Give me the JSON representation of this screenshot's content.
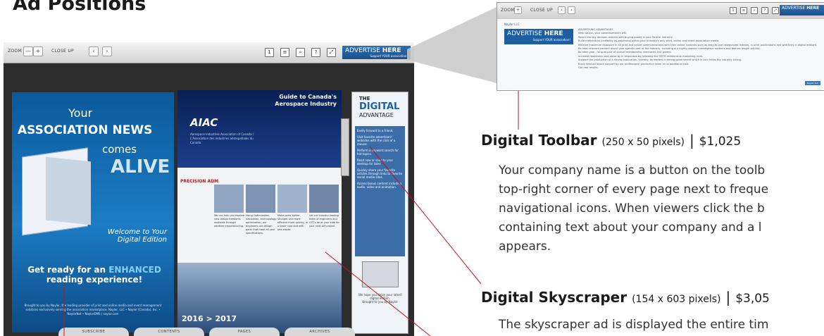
{
  "heading": "Ad Positions",
  "viewer": {
    "toolbar": {
      "zoom_label": "ZOOM",
      "minus": "—",
      "plus": "+",
      "closeup_label": "CLOSE UP",
      "prev": "‹",
      "next": "›",
      "icons": [
        "page-icon",
        "grid-icon",
        "search-icon",
        "help-icon",
        "fullscreen-icon"
      ],
      "icon_glyphs": [
        "1",
        "≡",
        "⌕",
        "?",
        "⤢"
      ],
      "advertise_main": "ADVERTISE ",
      "advertise_here": "HERE",
      "advertise_sub": "Support YOUR association!"
    },
    "cover": {
      "your": "Your",
      "assoc_news": "ASSOCIATION NEWS",
      "comes": "comes",
      "alive": "ALIVE",
      "welcome": "Welcome to Your Digital Edition",
      "get_ready": "Get ready for an ",
      "enhanced": "ENHANCED",
      "reading_exp": "reading experience!",
      "footer": "Brought to you by Naylor, the leading provider of print and online media and event management solutions exclusively serving the association marketplace. Naylor, LLC • Naylor (Canada), Inc. • NaylorNet • NaylorDMS | naylor.com"
    },
    "magazine": {
      "guide_title": "Guide to Canada's Aerospace Industry",
      "aiac": "AIAC",
      "aiac_sub": "Aerospace Industries Association of Canada / L'Association des industries aérospatiales du Canada",
      "precision": "PRECISION ADM",
      "col1": "We can help you explore new design freedoms available through additive manufacturing.",
      "col2": "Using Optimization, simulation, and topology optimization, our engineers can design parts that meet all your specifications.",
      "col3": "Make parts lighter, stronger and more efficient more quickly, at a lower cost and with less waste.",
      "col4": "Let our industry-leading team of engineers and CET's be at your side for your next AM project.",
      "year": "2016 > 2017"
    },
    "skyscraper": {
      "the": "THE",
      "digital": "DIGITAL",
      "advantage": "ADVANTAGE",
      "items": [
        "Easily forward to a friend.",
        "Visit favorite advertisers' websites with the click of a mouse.",
        "Perform a keyword search for hot topics.",
        "Read now or save to your desktop for later.",
        "Quickly share your favorite articles through links to favorite social media sites.",
        "Access bonus content including audio, video and animation."
      ],
      "hope": "We hope you enjoy your latest digital edition.",
      "brought": "Brought to you by Naylor"
    },
    "tabs": [
      "SUBSCRIBE",
      "CONTENTS",
      "PAGES",
      "ARCHIVES"
    ]
  },
  "zoom": {
    "zoom_label": "ZOOM",
    "closeup_label": "CLOSE UP",
    "header_small": "Naylor LLC",
    "advertise_main": "ADVERTISE ",
    "advertise_here": "HERE",
    "advertise_sub": "Support YOUR association!",
    "lines": [
      "ADVERTISING ADVANTAGES",
      "With Naylor, your advertisements will:",
      "Reach the key decision-makers with buying power in your field or industry.",
      "Build momentum credibility by appearing within your industry's only print, online and event association media.",
      "Receive maximum exposure in all print and online communications with their online contents such as easy-to-use categorized indexes, in print publications and web links in digital editions.",
      "Be near relevant content about your specific part of the industry, including our highly popular marketplace sections and feature length articles.",
      "Be seen year - long as part of annual membership directories and guides.",
      "Increase readership and value by in responses by following the CDTB relationship marketing rules.",
      "Support the production of a strong publication, thereby, as leaders in strong government which in turn helps the industry strong.",
      "Enjoy feed ad layout support by our professional production team at no additional cost.",
      "Get real results."
    ],
    "link": "Naylor LLC"
  },
  "ads": [
    {
      "name": "Digital Toolbar",
      "dims": "(250 x 50 pixels)",
      "separator": "|",
      "price": "$1,025",
      "description": "Your company name is a button on the toolb\ntop-right corner of every page next to freque\nnavigational icons. When viewers click the b\ncontaining text about your company and a l\nappears."
    },
    {
      "name": "Digital Skyscraper",
      "dims": "(154 x 603 pixels)",
      "separator": "|",
      "price": "$3,05",
      "description": "The skyscraper ad is displayed the entire tim"
    }
  ]
}
